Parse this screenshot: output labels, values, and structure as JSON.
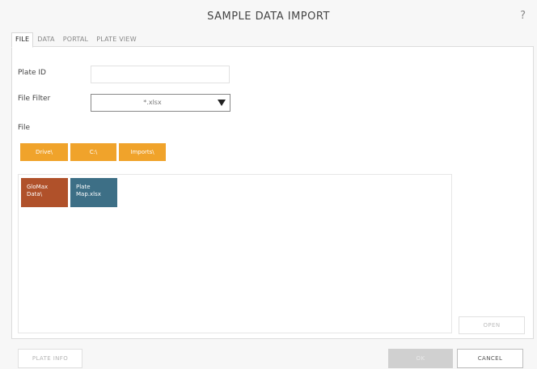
{
  "window": {
    "title": "SAMPLE DATA IMPORT",
    "help_label": "?"
  },
  "tabs": [
    {
      "label": "FILE",
      "active": true
    },
    {
      "label": "DATA",
      "active": false
    },
    {
      "label": "PORTAL",
      "active": false
    },
    {
      "label": "PLATE VIEW",
      "active": false
    }
  ],
  "form": {
    "plate_id_label": "Plate ID",
    "plate_id_value": "",
    "file_filter_label": "File Filter",
    "file_filter_value": "*.xlsx",
    "file_label": "File"
  },
  "breadcrumbs": [
    {
      "label": "Drive\\"
    },
    {
      "label": "C:\\"
    },
    {
      "label": "Imports\\"
    }
  ],
  "browser_items": [
    {
      "line1": "GloMax",
      "line2": "Data\\",
      "type": "folder"
    },
    {
      "line1": "Plate",
      "line2": "Map.xlsx",
      "type": "file"
    }
  ],
  "buttons": {
    "open_label": "OPEN",
    "plate_info_label": "PLATE INFO",
    "ok_label": "OK",
    "cancel_label": "CANCEL"
  },
  "colors": {
    "breadcrumb": "#f0a32b",
    "folder_tile": "#b0512a",
    "file_tile": "#3d6f86",
    "ok_disabled": "#d0d0d0"
  }
}
